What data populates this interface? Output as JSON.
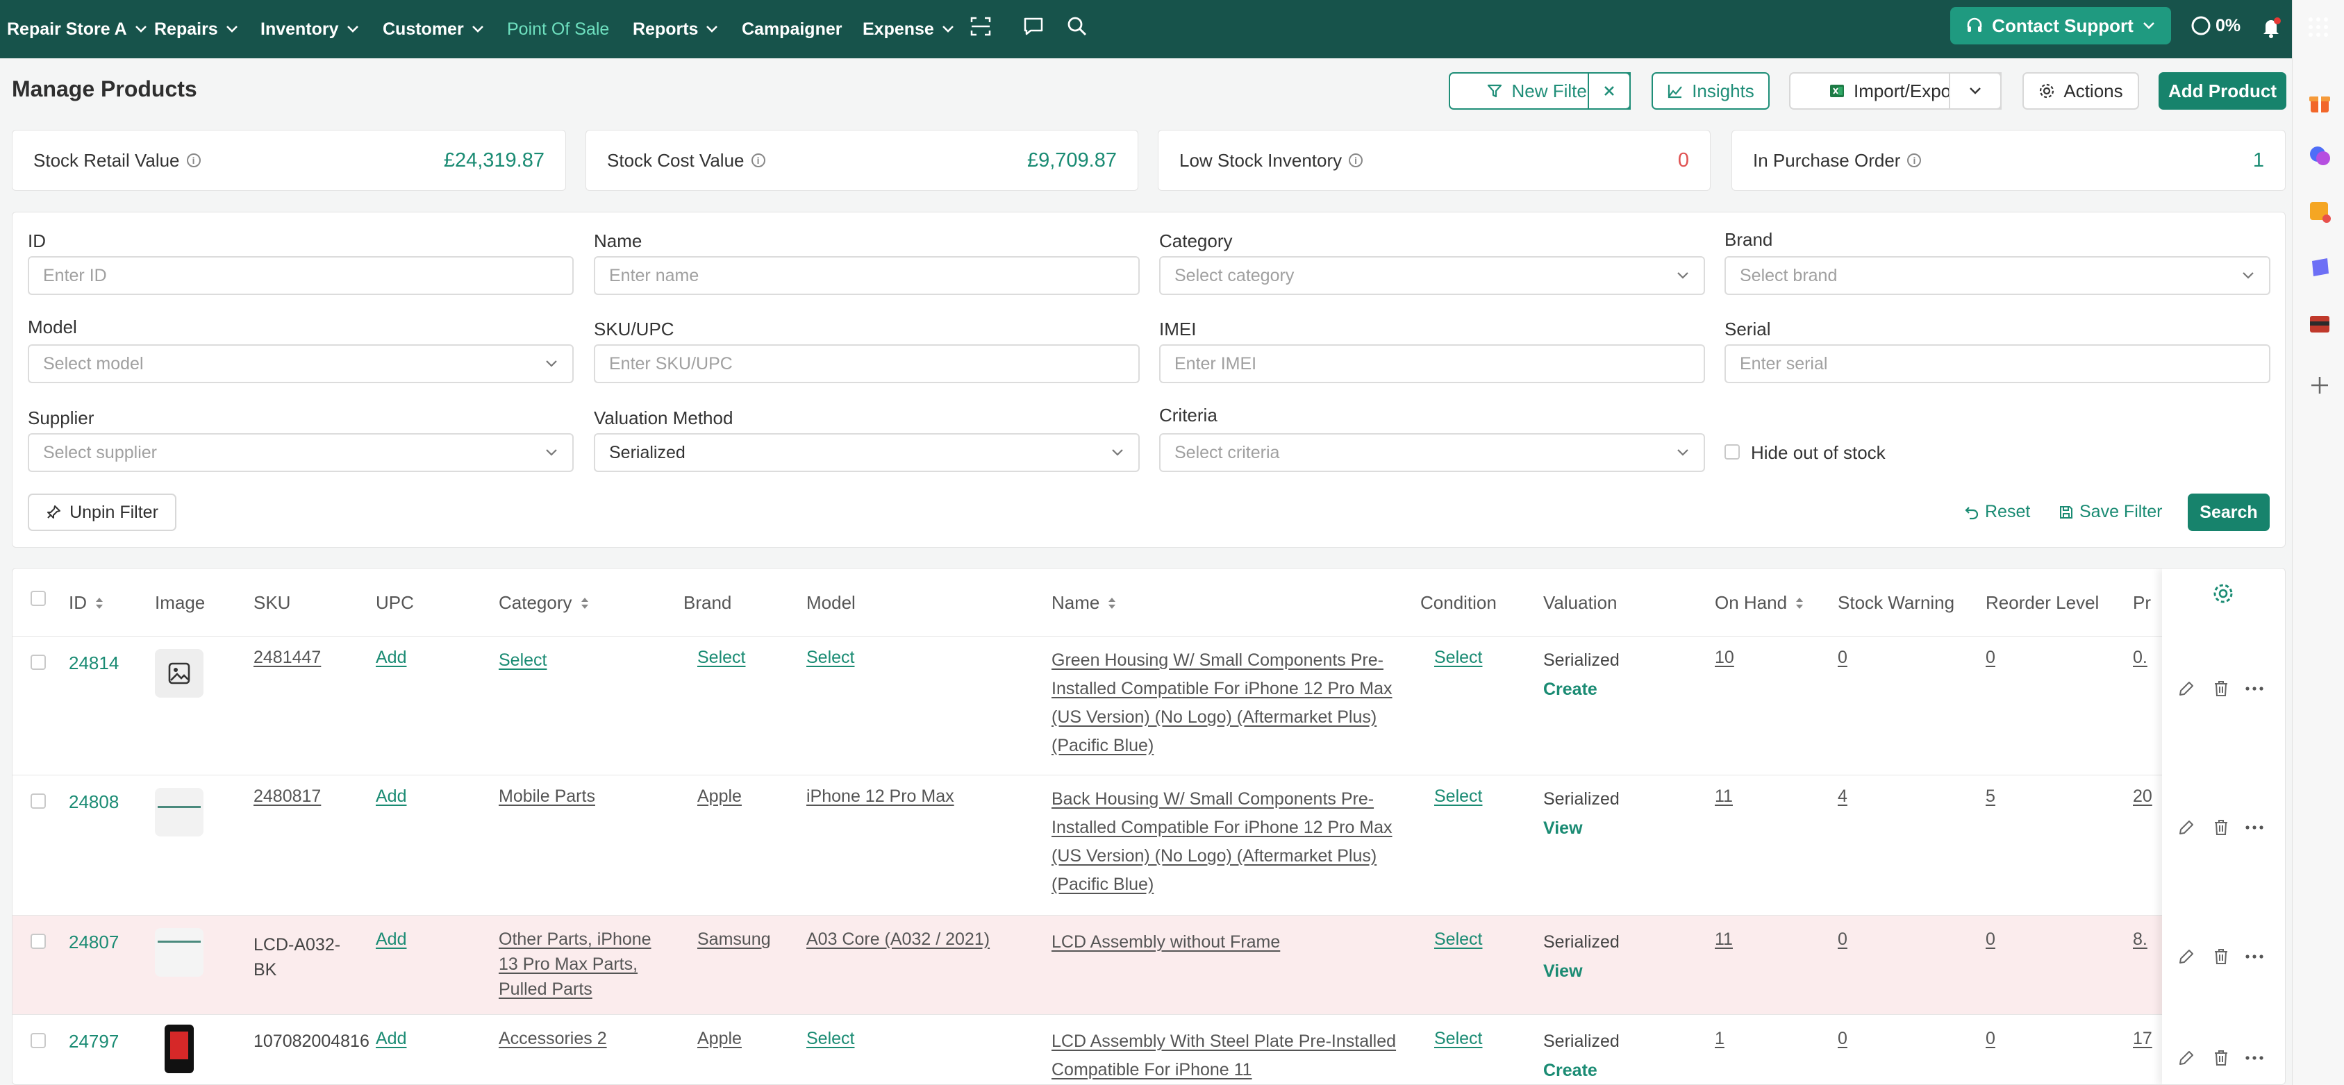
{
  "nav": {
    "store": "Repair Store A",
    "items": [
      {
        "label": "Repairs"
      },
      {
        "label": "Inventory"
      },
      {
        "label": "Customer"
      },
      {
        "label": "Point Of Sale"
      },
      {
        "label": "Reports"
      },
      {
        "label": "Campaigner"
      },
      {
        "label": "Expense"
      }
    ],
    "contact_support": "Contact Support",
    "progress": "0%"
  },
  "header": {
    "title": "Manage Products",
    "new_filter": "New Filter",
    "insights": "Insights",
    "import_export": "Import/Export",
    "actions": "Actions",
    "add_product": "Add Product"
  },
  "stats": [
    {
      "label": "Stock Retail Value",
      "value": "£24,319.87",
      "color": "#1a8b73"
    },
    {
      "label": "Stock Cost Value",
      "value": "£9,709.87",
      "color": "#1a8b73"
    },
    {
      "label": "Low Stock Inventory",
      "value": "0",
      "color": "#e05252"
    },
    {
      "label": "In Purchase Order",
      "value": "1",
      "color": "#1a8b73"
    }
  ],
  "filters": {
    "id": {
      "label": "ID",
      "placeholder": "Enter ID"
    },
    "name": {
      "label": "Name",
      "placeholder": "Enter name"
    },
    "category": {
      "label": "Category",
      "placeholder": "Select category"
    },
    "brand": {
      "label": "Brand",
      "placeholder": "Select brand"
    },
    "model": {
      "label": "Model",
      "placeholder": "Select model"
    },
    "sku": {
      "label": "SKU/UPC",
      "placeholder": "Enter SKU/UPC"
    },
    "imei": {
      "label": "IMEI",
      "placeholder": "Enter IMEI"
    },
    "serial": {
      "label": "Serial",
      "placeholder": "Enter serial"
    },
    "supplier": {
      "label": "Supplier",
      "placeholder": "Select supplier"
    },
    "valuation": {
      "label": "Valuation Method",
      "value": "Serialized"
    },
    "criteria": {
      "label": "Criteria",
      "placeholder": "Select criteria"
    },
    "hide_out_of_stock": "Hide out of stock",
    "unpin": "Unpin Filter",
    "reset": "Reset",
    "save_filter": "Save Filter",
    "search": "Search"
  },
  "table": {
    "columns": [
      "ID",
      "Image",
      "SKU",
      "UPC",
      "Category",
      "Brand",
      "Model",
      "Name",
      "Condition",
      "Valuation",
      "On Hand",
      "Stock Warning",
      "Reorder Level",
      "Pr"
    ],
    "rows": [
      {
        "id": "24814",
        "sku": "2481447",
        "upc": "Add",
        "category": "Select",
        "brand": "Select",
        "model": "Select",
        "name": "Green Housing W/ Small Components Pre-Installed Compatible For iPhone 12 Pro Max (US Version) (No Logo) (Aftermarket Plus) (Pacific Blue)",
        "condition": "Select",
        "valuation": "Serialized",
        "valuation_action": "Create",
        "on_hand": "10",
        "stock_warning": "0",
        "reorder_level": "0",
        "price": "0."
      },
      {
        "id": "24808",
        "sku": "2480817",
        "upc": "Add",
        "category": "Mobile Parts",
        "brand": "Apple",
        "model": "iPhone 12 Pro Max",
        "name": "Back Housing W/ Small Components Pre-Installed Compatible For iPhone 12 Pro Max (US Version) (No Logo) (Aftermarket Plus) (Pacific Blue)",
        "condition": "Select",
        "valuation": "Serialized",
        "valuation_action": "View",
        "on_hand": "11",
        "stock_warning": "4",
        "reorder_level": "5",
        "price": "20"
      },
      {
        "id": "24807",
        "sku": "LCD-A032-BK",
        "upc": "Add",
        "category": "Other Parts, iPhone 13 Pro Max Parts, Pulled Parts",
        "brand": "Samsung",
        "model": "A03 Core (A032 / 2021)",
        "name": "LCD Assembly without Frame",
        "condition": "Select",
        "valuation": "Serialized",
        "valuation_action": "View",
        "on_hand": "11",
        "stock_warning": "0",
        "reorder_level": "0",
        "price": "8."
      },
      {
        "id": "24797",
        "sku": "107082004816",
        "upc": "Add",
        "category": "Accessories 2",
        "brand": "Apple",
        "model": "Select",
        "name": "LCD Assembly With Steel Plate Pre-Installed Compatible For iPhone 11",
        "condition": "Select",
        "valuation": "Serialized",
        "valuation_action": "Create",
        "on_hand": "1",
        "stock_warning": "0",
        "reorder_level": "0",
        "price": "17"
      }
    ]
  }
}
